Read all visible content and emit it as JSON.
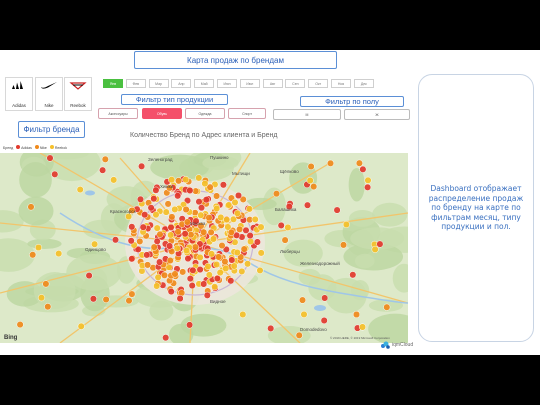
{
  "callouts": {
    "map_title": "Карта продаж по брендам",
    "product_filter": "Фильтр тип продукции",
    "gender_filter": "Фильтр по полу",
    "brand_filter": "Фильтр бренда"
  },
  "brands": [
    {
      "label": "Adidas",
      "icon": "adidas-logo-icon"
    },
    {
      "label": "Nike",
      "icon": "nike-logo-icon"
    },
    {
      "label": "Reebok",
      "icon": "reebok-logo-icon"
    }
  ],
  "months": [
    "Янв",
    "Фев",
    "Мар",
    "Апр",
    "Май",
    "Июн",
    "Июл",
    "Авг",
    "Сен",
    "Окт",
    "Ноя",
    "Дек"
  ],
  "product_types": [
    "Аксессуары",
    "Обувь",
    "Одежда",
    "Спорт"
  ],
  "genders": [
    "М",
    "Ж"
  ],
  "map": {
    "title": "Количество Бренд по Адрес клиента и Бренд",
    "legend_label": "Бренд",
    "legend_items": [
      {
        "name": "Adidas",
        "color": "#e23a2e"
      },
      {
        "name": "Nike",
        "color": "#f08a1c"
      },
      {
        "name": "Reebok",
        "color": "#f5c02a"
      }
    ],
    "places": [
      "Зеленоград",
      "Пушкино",
      "Мытищи",
      "Щёлково",
      "Химки",
      "Балашиха",
      "Красногорск",
      "Москва",
      "Люберцы",
      "Одинцово",
      "Железнодорожный",
      "Видное",
      "Domodedovo"
    ],
    "bing": "Bing",
    "copyright": "© 2019 HERE, © 2019 Microsoft Corporation"
  },
  "description": "Dashboard отображает распределение продаж по бренду на карте по фильтрам месяц, типу продукции и пол.",
  "footer": "iqmCloud",
  "colors": {
    "callout_border": "#5b8fd6",
    "selected_month": "#4ac040",
    "selected_product": "#f4506a"
  }
}
